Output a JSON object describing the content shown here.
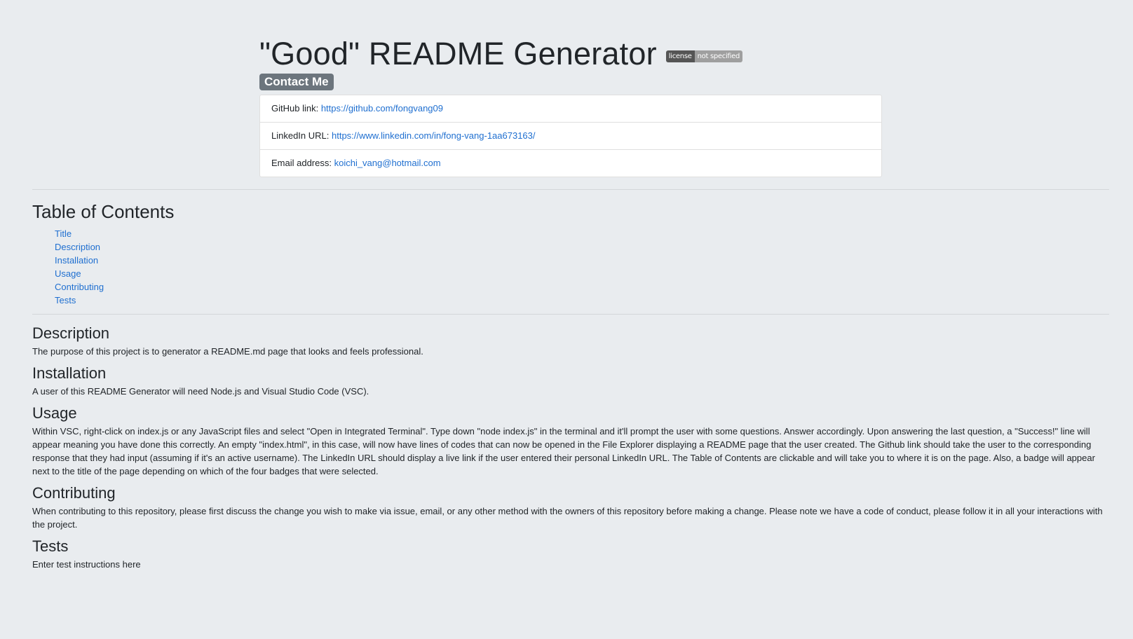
{
  "header": {
    "title": "\"Good\" README Generator",
    "license_badge": {
      "label": "license",
      "value": "not specified"
    },
    "contact_label": "Contact Me"
  },
  "contact": {
    "github": {
      "label": "GitHub link: ",
      "value": "https://github.com/fongvang09"
    },
    "linkedin": {
      "label": "LinkedIn URL: ",
      "value": "https://www.linkedin.com/in/fong-vang-1aa673163/"
    },
    "email": {
      "label": "Email address: ",
      "value": "koichi_vang@hotmail.com"
    }
  },
  "toc": {
    "title": "Table of Contents",
    "items": [
      "Title",
      "Description",
      "Installation",
      "Usage",
      "Contributing",
      "Tests"
    ]
  },
  "sections": {
    "description": {
      "heading": "Description",
      "text": "The purpose of this project is to generator a README.md page that looks and feels professional."
    },
    "installation": {
      "heading": "Installation",
      "text": "A user of this README Generator will need Node.js and Visual Studio Code (VSC)."
    },
    "usage": {
      "heading": "Usage",
      "text": "Within VSC, right-click on index.js or any JavaScript files and select \"Open in Integrated Terminal\". Type down \"node index.js\" in the terminal and it'll prompt the user with some questions. Answer accordingly. Upon answering the last question, a \"Success!\" line will appear meaning you have done this correctly. An empty \"index.html\", in this case, will now have lines of codes that can now be opened in the File Explorer displaying a README page that the user created. The Github link should take the user to the corresponding response that they had input (assuming if it's an active username). The LinkedIn URL should display a live link if the user entered their personal LinkedIn URL. The Table of Contents are clickable and will take you to where it is on the page. Also, a badge will appear next to the title of the page depending on which of the four badges that were selected."
    },
    "contributing": {
      "heading": "Contributing",
      "text": "When contributing to this repository, please first discuss the change you wish to make via issue, email, or any other method with the owners of this repository before making a change. Please note we have a code of conduct, please follow it in all your interactions with the project."
    },
    "tests": {
      "heading": "Tests",
      "text": "Enter test instructions here"
    }
  },
  "colors": {
    "background": "#e9ecef",
    "link": "#1f6fd0",
    "badge": "#6c757d"
  }
}
